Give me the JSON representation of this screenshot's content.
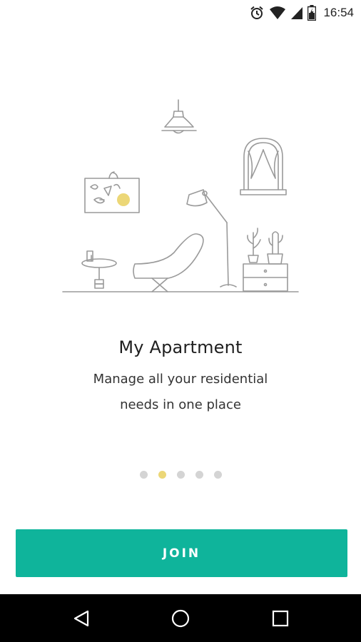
{
  "status_bar": {
    "time": "16:54",
    "icons": [
      "alarm-icon",
      "wifi-icon",
      "signal-icon",
      "battery-icon"
    ]
  },
  "onboarding": {
    "title": "My Apartment",
    "subtitle_line1": "Manage all your residential",
    "subtitle_line2": "needs in one place",
    "pager": {
      "count": 5,
      "active_index": 1
    }
  },
  "join_button": {
    "label": "JOIN"
  },
  "nav_bar": {
    "buttons": [
      "back-icon",
      "home-icon",
      "recents-icon"
    ]
  },
  "colors": {
    "accent": "#0fb49b",
    "highlight_yellow": "#ecd777",
    "dot_inactive": "#d4d4d4",
    "line_art": "#9a9a9a"
  }
}
